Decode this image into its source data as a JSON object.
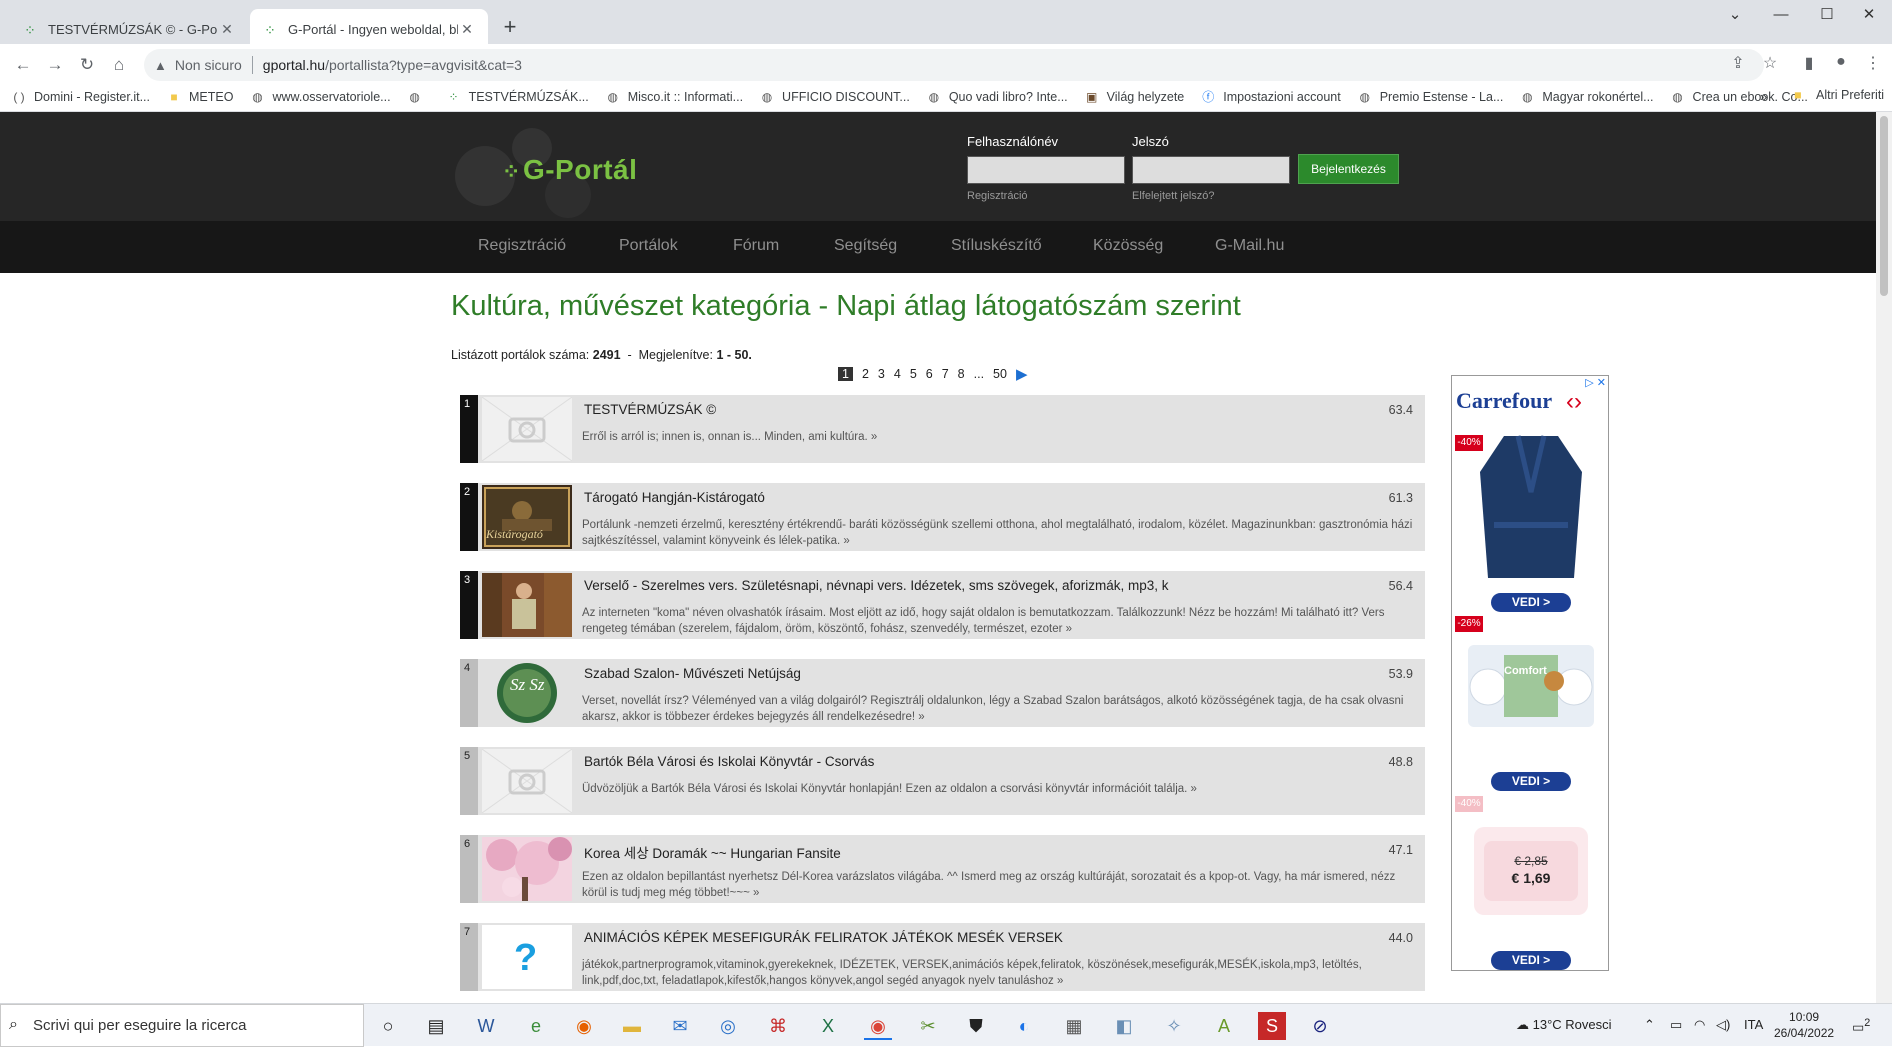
{
  "browser": {
    "tabs": [
      {
        "title": "TESTVÉRMÚZSÁK © - G-Portál",
        "active": false
      },
      {
        "title": "G-Portál - Ingyen weboldal, blog",
        "active": true
      }
    ],
    "security_label": "Non sicuro",
    "url_host": "gportal.hu",
    "url_path": "/portallista?type=avgvisit&cat=3",
    "bookmarks": [
      "Domini - Register.it...",
      "METEO",
      "www.osservatoriole...",
      "TESTVÉRMÚZSÁK...",
      "Misco.it :: Informati...",
      "UFFICIO DISCOUNT...",
      "Quo vadi libro? Inte...",
      "Világ helyzete",
      "Impostazioni account",
      "Premio Estense - La...",
      "Magyar rokonértel...",
      "Crea un ebook. Co..."
    ],
    "bookmarks_more": "»",
    "other_bookmarks": "Altri Preferiti"
  },
  "site": {
    "logo": "G-Portál",
    "login": {
      "username_label": "Felhasználónév",
      "password_label": "Jelszó",
      "submit_label": "Bejelentkezés",
      "register_link": "Regisztráció",
      "forgot_link": "Elfelejtett jelszó?"
    },
    "nav": [
      "Regisztráció",
      "Portálok",
      "Fórum",
      "Segítség",
      "Stíluskészítő",
      "Közösség",
      "G-Mail.hu"
    ]
  },
  "content": {
    "title": "Kultúra, művészet kategória - Napi átlag látogatószám szerint",
    "count_label": "Listázott portálok száma:",
    "count_value": "2491",
    "shown_label": "Megjelenítve:",
    "shown_value": "1 - 50.",
    "pager": {
      "current": "1",
      "pages": [
        "2",
        "3",
        "4",
        "5",
        "6",
        "7",
        "8",
        "...",
        "50"
      ],
      "next_icon": "play-arrow-icon"
    },
    "portals": [
      {
        "rank": "1",
        "title": "TESTVÉRMÚZSÁK ©",
        "score": "63.4",
        "description": "Erről is arról is; innen is, onnan is... Minden, ami kultúra. »",
        "thumb": "camera-placeholder"
      },
      {
        "rank": "2",
        "title": "Tárogató Hangján-Kistárogató",
        "score": "61.3",
        "description": "Portálunk -nemzeti érzelmű, keresztény értékrendű- baráti közösségünk szellemi otthona, ahol megtalálható, irodalom, közélet. Magazinunkban: gasztronómia házi sajtkészítéssel, valamint könyveink és lélek-patika. »",
        "thumb": "painting-kistarogato",
        "thumb_text": "Kistárogató"
      },
      {
        "rank": "3",
        "title": "Verselő - Szerelmes vers. Születésnapi, névnapi vers. Idézetek, sms szövegek, aforizmák, mp3, k",
        "score": "56.4",
        "description": "Az interneten \"koma\" néven olvashatók írásaim. Most eljött az idő, hogy saját oldalon is bemutatkozzam. Találkozzunk! Nézz be hozzám! Mi található itt? Vers rengeteg témában (szerelem, fájdalom, öröm, köszöntő, fohász, szenvedély, természet, ezoter »",
        "thumb": "person-library"
      },
      {
        "rank": "4",
        "title": "Szabad Szalon- Művészeti Netújság",
        "score": "53.9",
        "description": "Verset, novellát írsz? Véleményed van a világ dolgairól? Regisztrálj oldalunkon, légy a Szabad Szalon barátságos, alkotó közösségének tagja, de ha csak olvasni akarsz, akkor is többezer érdekes bejegyzés áll rendelkezésedre! »",
        "thumb": "szsz-logo",
        "thumb_text": "Sz Sz"
      },
      {
        "rank": "5",
        "title": "Bartók Béla Városi és Iskolai Könyvtár - Csorvás",
        "score": "48.8",
        "description": "Üdvözöljük a Bartók Béla Városi és Iskolai Könyvtár honlapján! Ezen az oldalon a csorvási könyvtár információit találja. »",
        "thumb": "camera-placeholder"
      },
      {
        "rank": "6",
        "title": "Korea 세상 Doramák ~~ Hungarian Fansite",
        "score": "47.1",
        "description": "Ezen az oldalon bepillantást nyerhetsz Dél-Korea varázslatos világába. ^^ Ismerd meg az ország kultúráját, sorozatait és a kpop-ot. Vagy, ha már ismered, nézz körül is tudj meg még többet!~~~ »",
        "thumb": "cherry-blossom"
      },
      {
        "rank": "7",
        "title": "ANIMÁCIÓS KÉPEK MESEFIGURÁK FELIRATOK JÁTÉKOK MESÉK VERSEK",
        "score": "44.0",
        "description": "játékok,partnerprogramok,vitaminok,gyerekeknek, IDÉZETEK, VERSEK,animációs képek,feliratok, köszönések,mesefigurák,MESÉK,iskola,mp3, letöltés, link,pdf,doc,txt, feladatlapok,kifestők,hangos könyvek,angol segéd anyagok nyelv tanuláshoz »",
        "thumb": "question-mark",
        "thumb_text": "?"
      }
    ]
  },
  "ad": {
    "brand": "Carrefour",
    "close_icon": "close-icon",
    "items": [
      {
        "badge": "-40%",
        "cta": "VEDI >",
        "image": "blue-bathrobe"
      },
      {
        "badge": "-26%",
        "cta": "VEDI >",
        "image": "toilet-paper-pack",
        "product_text": "Comfort"
      },
      {
        "badge": "-40%",
        "cta": "VEDI >",
        "image": "pink-towels",
        "old_price": "€ 2,85",
        "new_price": "€ 1,69"
      }
    ]
  },
  "taskbar": {
    "search_placeholder": "Scrivi qui per eseguire la ricerca",
    "weather": "13°C  Rovesci",
    "language": "ITA",
    "time": "10:09",
    "date": "26/04/2022",
    "notifications": "2"
  }
}
